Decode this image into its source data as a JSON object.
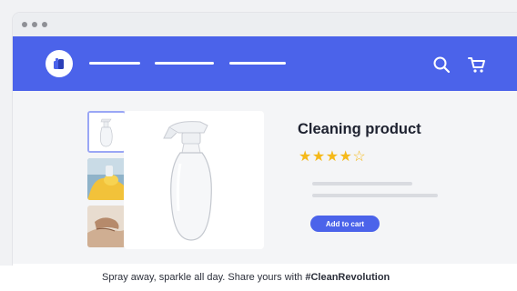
{
  "window": {
    "controls": [
      "dot",
      "dot",
      "dot"
    ]
  },
  "nav": {
    "logo_icon": "store-logo-icon",
    "menu_items": [
      "",
      "",
      ""
    ],
    "search_icon": "search-icon",
    "cart_icon": "cart-icon",
    "color": "#4b63ea"
  },
  "product": {
    "title": "Cleaning product",
    "rating": 4,
    "rating_max": 5,
    "stars": "★★★★",
    "star_empty": "☆",
    "add_to_cart": "Add to cart",
    "thumbnails": [
      "spray-bottle-thumbnail",
      "gloved-hand-spray-thumbnail",
      "cleaning-cloth-thumbnail"
    ],
    "main_image": "spray-bottle-image"
  },
  "footer": {
    "text": "Spray away, sparkle all day. Share yours with ",
    "hashtag": "#CleanRevolution"
  },
  "colors": {
    "accent": "#4b63ea",
    "star": "#f5b91a"
  }
}
